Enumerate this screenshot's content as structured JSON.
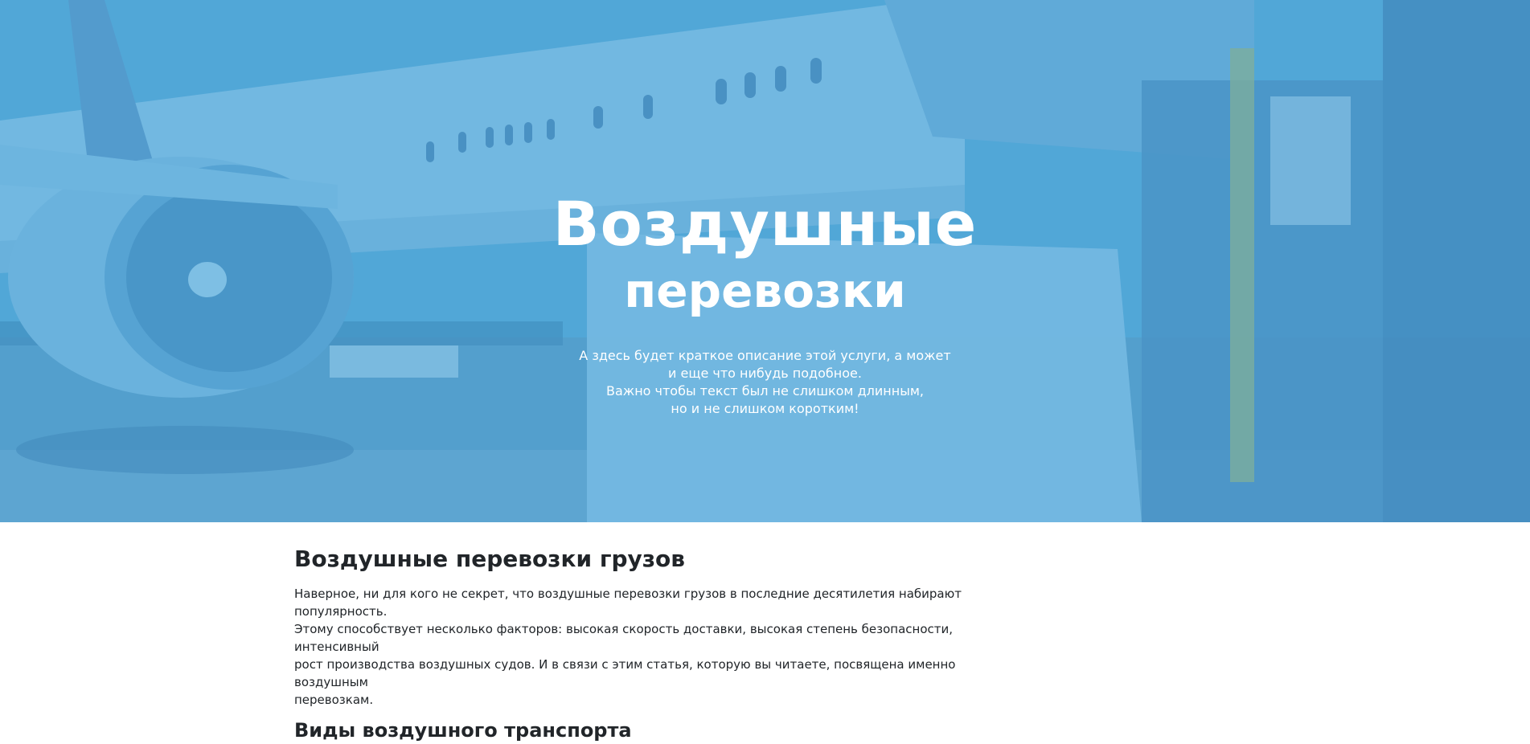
{
  "hero": {
    "title_line1": "Воздушные",
    "title_line2": "перевозки",
    "description_lines": [
      "А здесь будет краткое описание этой услуги, а может",
      "и еще что нибудь подобное.",
      "Важно чтобы текст был не слишком длинным,",
      "но и не слишком коротким!"
    ],
    "background_image": "cargo-airplane-photo",
    "overlay_color": "#4aa0d6"
  },
  "article": {
    "heading": "Воздушные перевозки грузов",
    "intro_lines": [
      "Наверное, ни для кого не секрет, что воздушные перевозки грузов в последние десятилетия набирают популярность.",
      "Этому способствует несколько факторов: высокая скорость доставки, высокая степень безопасности, интенсивный",
      "рост производства воздушных судов. И в связи с этим статья, которую вы читаете, посвящена именно воздушным",
      "перевозкам."
    ],
    "subheading": "Виды воздушного транспорта"
  },
  "colors": {
    "text": "#212529",
    "hero_text": "#ffffff"
  }
}
